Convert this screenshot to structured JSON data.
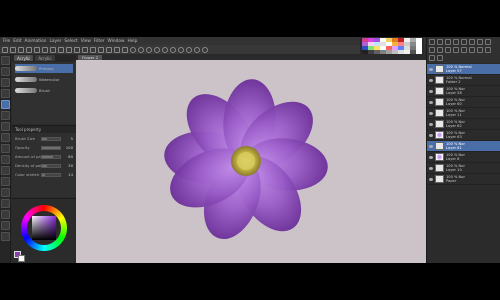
{
  "menu": [
    "File",
    "Edit",
    "Animation",
    "Layer",
    "Select",
    "View",
    "Filter",
    "Window",
    "Help"
  ],
  "subtool": {
    "tabs": [
      "Acrylic",
      "Acrylic"
    ],
    "brushes": [
      {
        "label": "Primary"
      },
      {
        "label": "Watercolor"
      },
      {
        "label": "Brush"
      }
    ]
  },
  "tool_property": {
    "header": "Tool property",
    "rows": [
      {
        "name": "Brush Size",
        "value": "5",
        "fill": 0.3
      },
      {
        "name": "Opacity",
        "value": "100",
        "fill": 1.0
      },
      {
        "name": "Amount of paint",
        "value": "60",
        "fill": 0.6
      },
      {
        "name": "Density of paint",
        "value": "30",
        "fill": 0.3
      },
      {
        "name": "Color stretch",
        "value": "14",
        "fill": 0.14
      }
    ]
  },
  "canvas": {
    "tab_label": "Flower 2",
    "background": "#ccc3c8"
  },
  "colors": {
    "main": "#8a3fb0",
    "sub": "#ffffff",
    "accent": "#4a6ea8"
  },
  "layers": [
    {
      "name": "100 % Normal",
      "name2": "Layer 57",
      "thumb": "blank",
      "selected": true
    },
    {
      "name": "100 % Normal",
      "name2": "Folder 2",
      "thumb": "blank",
      "selected": false
    },
    {
      "name": "100 % Nor",
      "name2": "Layer 58",
      "thumb": "blank",
      "selected": false
    },
    {
      "name": "100 % Nor",
      "name2": "Layer 60",
      "thumb": "blank",
      "selected": false
    },
    {
      "name": "100 % Nor",
      "name2": "Layer 11",
      "thumb": "blank",
      "selected": false
    },
    {
      "name": "100 % Nor",
      "name2": "Layer 62",
      "thumb": "blank",
      "selected": false
    },
    {
      "name": "100 % Nor",
      "name2": "Layer 63",
      "thumb": "purple",
      "selected": false
    },
    {
      "name": "100 % Nor",
      "name2": "Layer 61",
      "thumb": "blank",
      "selected": true
    },
    {
      "name": "100 % Nor",
      "name2": "Layer 8",
      "thumb": "purple",
      "selected": false
    },
    {
      "name": "100 % Nor",
      "name2": "Layer 10",
      "thumb": "blank",
      "selected": false
    },
    {
      "name": "100 % Nor",
      "name2": "Paper",
      "thumb": "blank",
      "selected": false
    }
  ],
  "swatches": [
    "#d04090",
    "#e040e0",
    "#a050e0",
    "#ffffff",
    "#f0d060",
    "#e08020",
    "#c02020",
    "#f0f0f0",
    "#aaaaaa",
    "#ffffff",
    "#b060d0",
    "#ffd0f0",
    "#c0e0ff",
    "#e0e0e0",
    "#ffffff",
    "#f8b040",
    "#ff8080",
    "#cccccc",
    "#888888",
    "#ffffff",
    "#3050c0",
    "#80e080",
    "#ffe060",
    "#ffffff",
    "#ff6060",
    "#e0a0ff",
    "#6080ff",
    "#dddddd",
    "#777777",
    "#ffffff",
    "#202020",
    "#404040",
    "#606060",
    "#808080",
    "#a0a0a0",
    "#c0c0c0",
    "#e0e0e0",
    "#f0f0f0",
    "#555555",
    "#ffffff"
  ]
}
